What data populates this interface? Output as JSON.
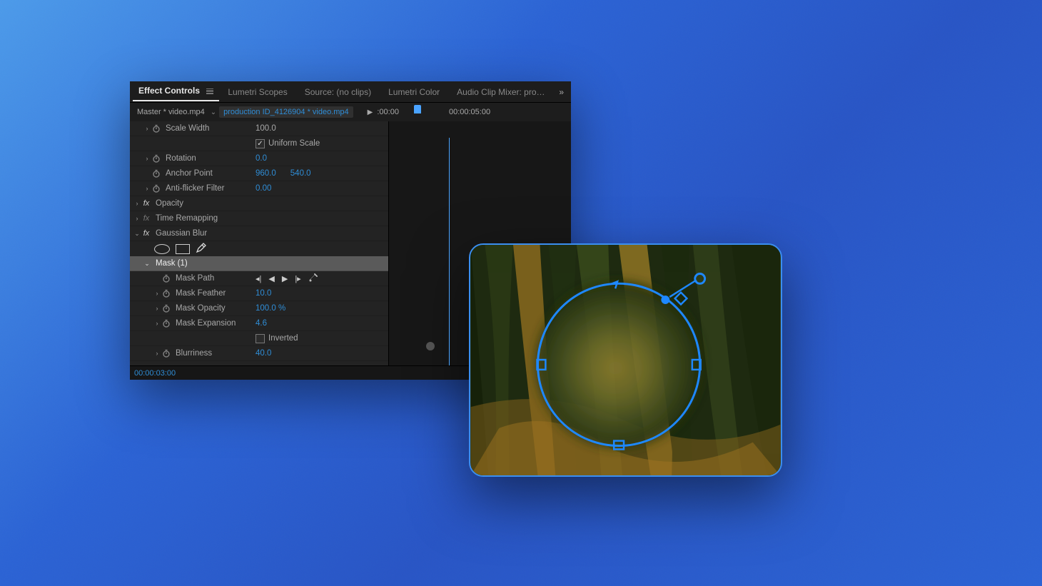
{
  "tabs": {
    "effect_controls": "Effect Controls",
    "lumetri_scopes": "Lumetri Scopes",
    "source": "Source: (no clips)",
    "lumetri_color": "Lumetri Color",
    "audio_mixer": "Audio Clip Mixer: produc"
  },
  "breadcrumb": {
    "master": "Master * video.mp4",
    "clip": "production ID_4126904 * video.mp4"
  },
  "timeline": {
    "tc_left": ":00:00",
    "tc_right": "00:00:05:00"
  },
  "props": {
    "scale_width": {
      "label": "Scale Width",
      "value": "100.0"
    },
    "uniform_scale": {
      "label": "Uniform Scale"
    },
    "rotation": {
      "label": "Rotation",
      "value": "0.0"
    },
    "anchor_point": {
      "label": "Anchor Point",
      "x": "960.0",
      "y": "540.0"
    },
    "anti_flicker": {
      "label": "Anti-flicker Filter",
      "value": "0.00"
    },
    "opacity": {
      "label": "Opacity"
    },
    "time_remapping": {
      "label": "Time Remapping"
    },
    "gaussian_blur": {
      "label": "Gaussian Blur"
    },
    "mask1": {
      "label": "Mask (1)"
    },
    "mask_path": {
      "label": "Mask Path"
    },
    "mask_feather": {
      "label": "Mask Feather",
      "value": "10.0"
    },
    "mask_opacity": {
      "label": "Mask Opacity",
      "value": "100.0 %"
    },
    "mask_expansion": {
      "label": "Mask Expansion",
      "value": "4.6"
    },
    "inverted": {
      "label": "Inverted"
    },
    "blurriness": {
      "label": "Blurriness",
      "value": "40.0"
    }
  },
  "footer": {
    "timecode": "00:00:03:00"
  }
}
